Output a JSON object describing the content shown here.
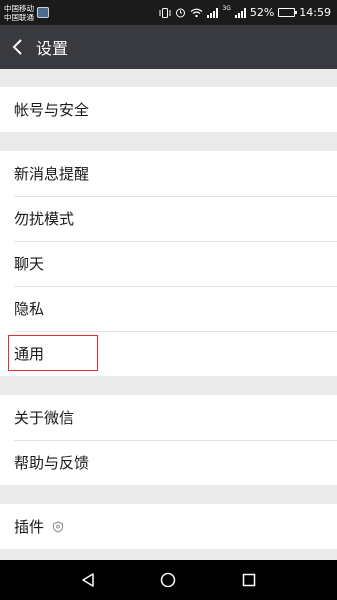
{
  "status_bar": {
    "carrier_1": "中国移动",
    "carrier_2": "中国联通",
    "network_badge": "3G",
    "battery_percent": "52%",
    "battery_level": 0.52,
    "time": "14:59"
  },
  "header": {
    "title": "设置"
  },
  "groups": [
    {
      "items": [
        {
          "label": "帐号与安全"
        }
      ]
    },
    {
      "items": [
        {
          "label": "新消息提醒"
        },
        {
          "label": "勿扰模式"
        },
        {
          "label": "聊天"
        },
        {
          "label": "隐私"
        },
        {
          "label": "通用"
        }
      ]
    },
    {
      "items": [
        {
          "label": "关于微信"
        },
        {
          "label": "帮助与反馈"
        }
      ]
    },
    {
      "items": [
        {
          "label": "插件"
        }
      ]
    }
  ],
  "colors": {
    "title_bar": "#393a3f",
    "status_bar": "#1b1b1b",
    "background": "#ebebeb",
    "highlight": "#e0312f"
  },
  "icons": {
    "back": "chevron-left-icon",
    "plugin": "plugin-shield-icon",
    "nav_back": "triangle-back-icon",
    "nav_home": "circle-home-icon",
    "nav_recent": "square-recent-icon"
  }
}
